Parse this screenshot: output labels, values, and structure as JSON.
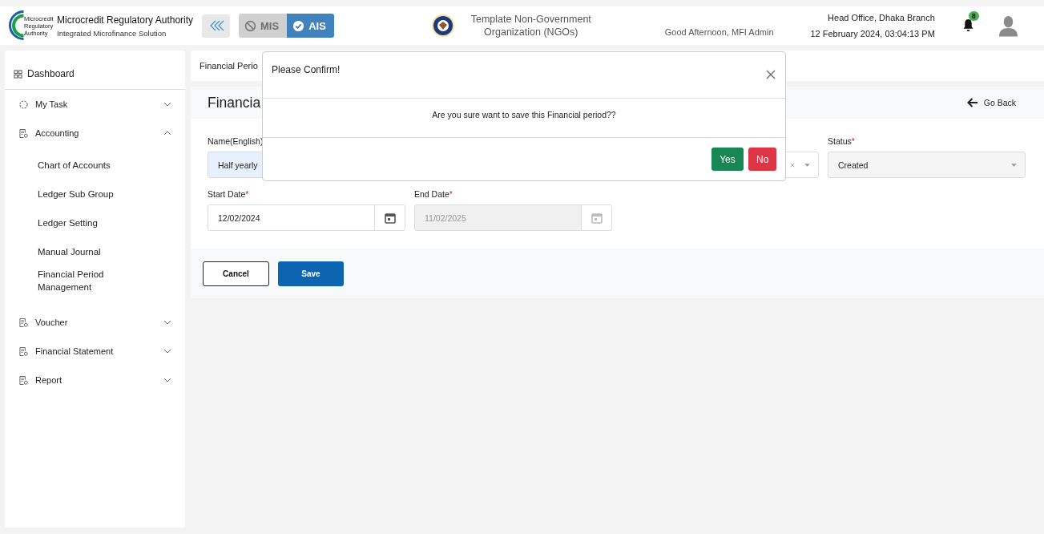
{
  "header": {
    "logo_text": [
      "Microcredit",
      "Regulatory",
      "Authority"
    ],
    "title": "Microcredit Regulatory Authority",
    "subtitle": "Integrated Microfinance Solution",
    "modules": [
      {
        "label": "MIS",
        "selected": false
      },
      {
        "label": "AIS",
        "selected": true
      }
    ],
    "org_name": "Template Non-Government Organization (NGOs)",
    "greeting": "Good Afternoon, MFI Admin",
    "branch": "Head Office, Dhaka Branch",
    "datetime": "12 February 2024, 03:04:13 PM",
    "notification_count": "8"
  },
  "sidebar": {
    "dashboard": "Dashboard",
    "items": [
      {
        "label": "My Task",
        "kind": "task",
        "expanded": false
      },
      {
        "label": "Accounting",
        "kind": "module",
        "expanded": true,
        "children": [
          {
            "label": "Chart of Accounts"
          },
          {
            "label": "Ledger Sub Group"
          },
          {
            "label": "Ledger Setting"
          },
          {
            "label": "Manual Journal"
          },
          {
            "label": "Financial Period Management"
          }
        ]
      },
      {
        "label": "Voucher",
        "kind": "module",
        "expanded": false
      },
      {
        "label": "Financial Statement",
        "kind": "module",
        "expanded": false
      },
      {
        "label": "Report",
        "kind": "module",
        "expanded": false
      }
    ]
  },
  "breadcrumb": "Financial Perio",
  "form": {
    "title": "Financia",
    "back_label": "Go Back",
    "rows": [
      [
        {
          "kind": "text",
          "label": "Name(English)",
          "value": "Half yearly",
          "disabled": false
        },
        {
          "kind": "select",
          "clearable": true,
          "disabled": false
        },
        {
          "kind": "select",
          "label": "Status",
          "required_mark": "*",
          "value": "Created",
          "disabled": false
        }
      ],
      [
        {
          "kind": "date",
          "label": "Start Date",
          "required_mark": "*",
          "value": "12/02/2024",
          "disabled": false
        },
        {
          "kind": "date",
          "label": "End Date",
          "required_mark": "*",
          "value": "11/02/2025",
          "disabled": true
        }
      ]
    ],
    "actions": [
      {
        "label": "Cancel",
        "kind": "secondary"
      },
      {
        "label": "Save",
        "kind": "primary"
      }
    ]
  },
  "dialog": {
    "title": "Please Confirm!",
    "message": "Are you sure want to save this Financial period??",
    "buttons": [
      {
        "label": "Yes",
        "kind": "confirm"
      },
      {
        "label": "No",
        "kind": "cancel"
      }
    ]
  }
}
